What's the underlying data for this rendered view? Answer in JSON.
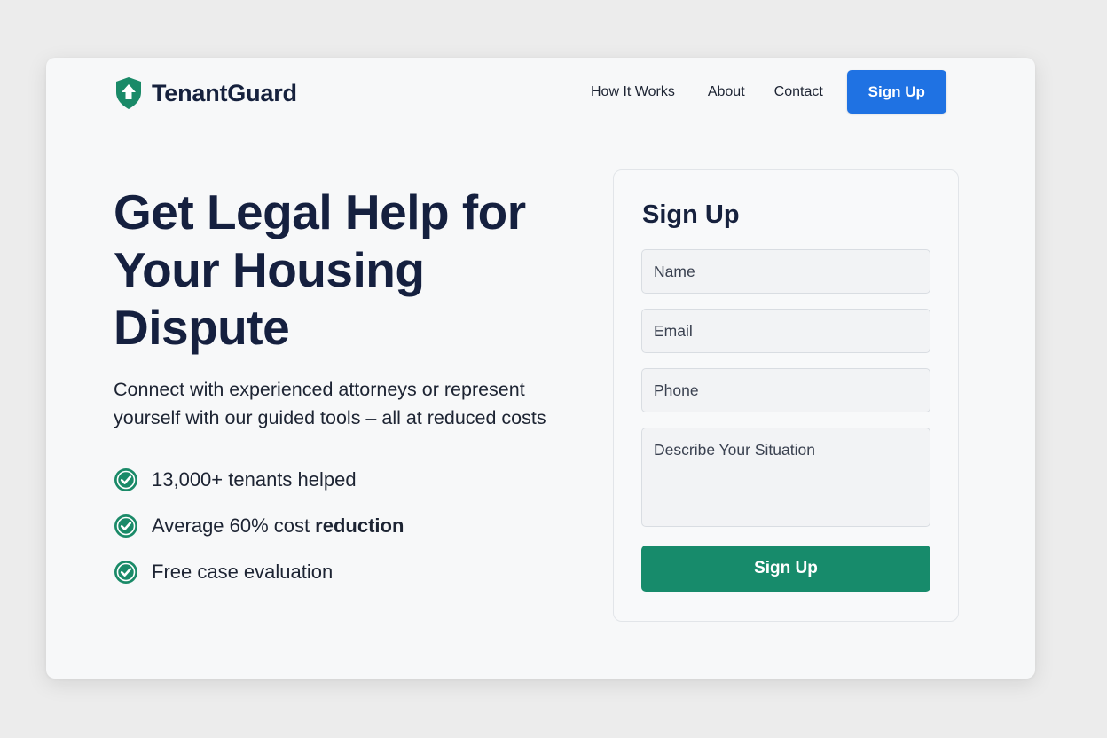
{
  "header": {
    "brand_name": "TenantGuard",
    "logo_icon": "shield-arrow-up-icon",
    "nav": [
      {
        "label": "How It Works"
      },
      {
        "label": "About"
      },
      {
        "label": "Contact"
      }
    ],
    "signup_label": "Sign Up"
  },
  "hero": {
    "title": "Get Legal Help for Your Housing Dispute",
    "subtitle": "Connect with experienced attorneys or represent yourself with our guided tools – all at reduced costs",
    "features": [
      {
        "text": "13,000+ tenants helped",
        "bold": "",
        "icon": "check-circle-icon"
      },
      {
        "text": "Average 60% cost",
        "bold": "reduction",
        "icon": "check-circle-icon"
      },
      {
        "text": "Free case evaluation",
        "bold": "",
        "icon": "check-circle-icon"
      }
    ]
  },
  "signup_form": {
    "title": "Sign Up",
    "name_placeholder": "Name",
    "email_placeholder": "Email",
    "phone_placeholder": "Phone",
    "situation_placeholder": "Describe Your Situation",
    "submit_label": "Sign Up"
  },
  "colors": {
    "brand_green": "#1a8a68",
    "primary_blue": "#1f72e3",
    "submit_green": "#178b6b",
    "heading_navy": "#15203f"
  }
}
